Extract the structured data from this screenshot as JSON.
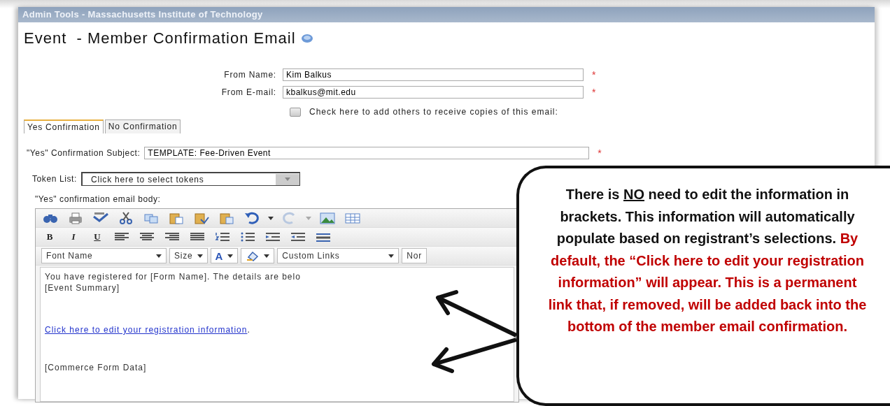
{
  "window": {
    "title": "Admin Tools - Massachusetts Institute of Technology"
  },
  "page": {
    "title": "Event  - Member Confirmation Email"
  },
  "sender": [
    {
      "label": "From Name:",
      "value": "Kim Balkus",
      "required_mark": "*"
    },
    {
      "label": "From E-mail:",
      "value": "kbalkus@mit.edu",
      "required_mark": "*"
    }
  ],
  "copies": {
    "label": "Check here to add others to receive copies of this email:",
    "checked": false
  },
  "tabs": [
    {
      "label": "Yes Confirmation",
      "selected": true
    },
    {
      "label": "No Confirmation",
      "selected": false
    }
  ],
  "subject": {
    "label": "\"Yes\" Confirmation Subject:",
    "value": "TEMPLATE: Fee-Driven Event",
    "required_mark": "*"
  },
  "token_list": {
    "label": "Token List:",
    "value": "Click here to select tokens"
  },
  "body": {
    "label": "\"Yes\" confirmation email body:",
    "format_buttons": [
      "B",
      "I",
      "U"
    ],
    "dropdowns": [
      {
        "kind": "select",
        "label": "Font Name"
      },
      {
        "kind": "select",
        "label": "Size"
      },
      {
        "kind": "font-color",
        "label": "A"
      },
      {
        "kind": "highlight"
      },
      {
        "kind": "select",
        "label": "Custom Links"
      },
      {
        "kind": "select",
        "label": "Nor"
      }
    ],
    "content": [
      {
        "kind": "text",
        "text": "You have registered for [Form Name]. The details are belo"
      },
      {
        "kind": "text",
        "text": "[Event Summary]"
      },
      {
        "kind": "link",
        "text": "Click here to edit your registration information",
        "suffix": "."
      },
      {
        "kind": "text",
        "text": "[Commerce Form Data]"
      }
    ]
  },
  "callout": {
    "segments": [
      {
        "text": "There is ",
        "highlighted": false,
        "underline": false
      },
      {
        "text": "NO",
        "highlighted": false,
        "underline": true
      },
      {
        "text": " need to edit the information in brackets. This information will automatically populate based on registrant’s selections. ",
        "highlighted": false,
        "underline": false
      },
      {
        "text": "By default, the “Click here to edit your registration information” will appear. This is a permanent link that, if removed, will be added back into the bottom of the member email confirmation.",
        "highlighted": true,
        "underline": false
      }
    ]
  }
}
